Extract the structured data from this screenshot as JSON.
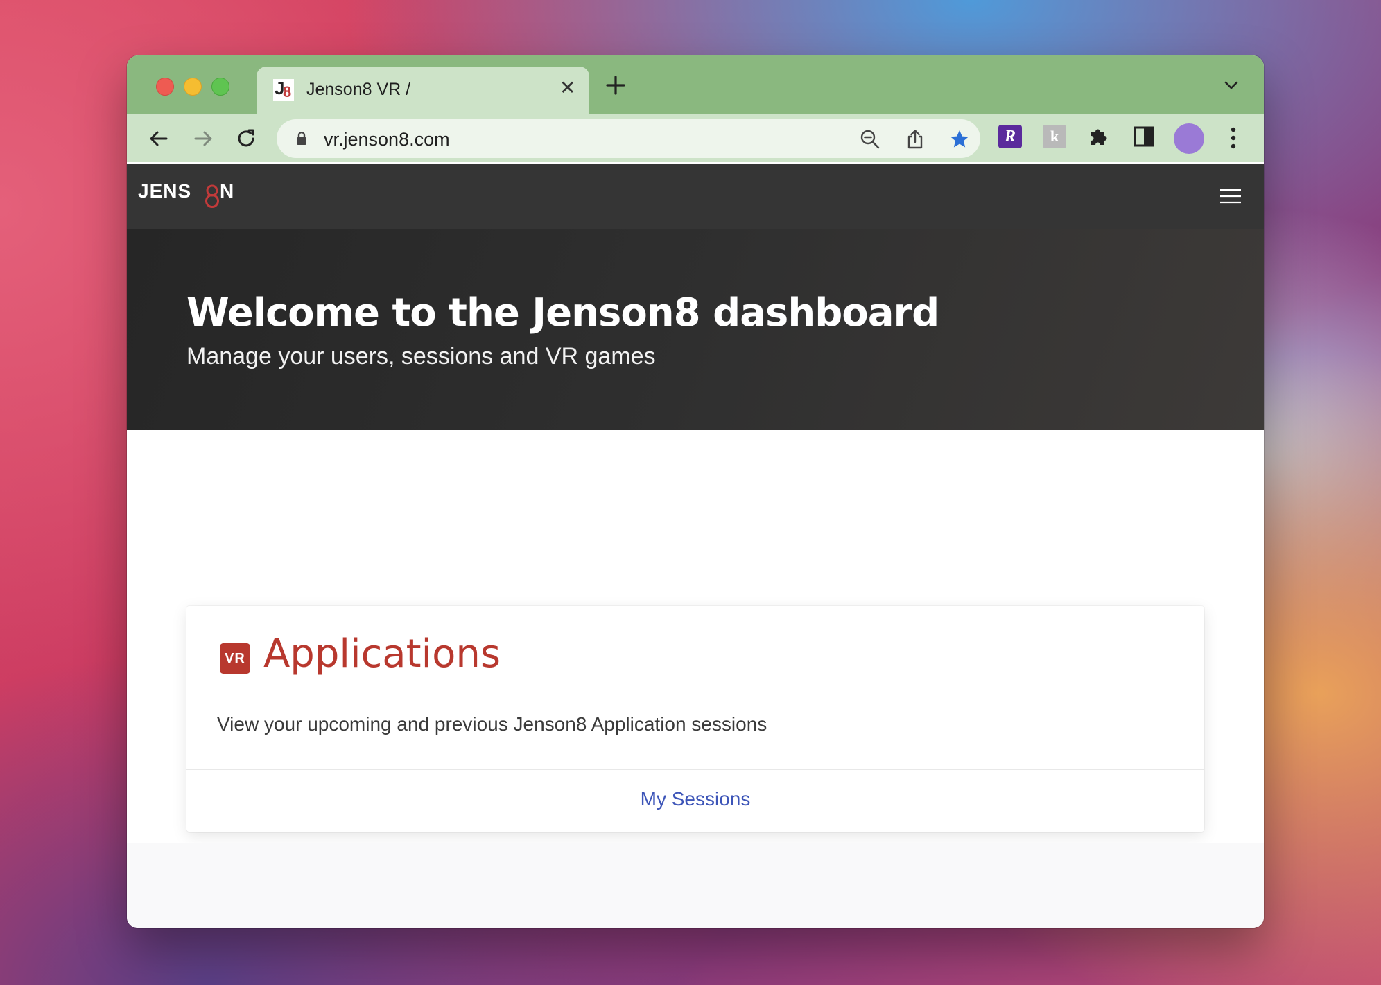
{
  "browser": {
    "tab": {
      "title": "Jenson8 VR /",
      "favicon": "jenson8-favicon"
    },
    "address_bar": {
      "url": "vr.jenson8.com"
    },
    "toolbar_icons": [
      "back-icon",
      "forward-icon",
      "reload-icon",
      "lock-icon",
      "zoom-out-icon",
      "share-icon",
      "bookmark-star-icon"
    ],
    "extensions": {
      "ext1_letter": "R",
      "ext2_letter": "k"
    }
  },
  "site": {
    "logo_text": "JENS8N",
    "hero": {
      "title": "Welcome to the Jenson8 dashboard",
      "subtitle": "Manage your users, sessions and VR games"
    },
    "card": {
      "badge": "VR",
      "title": "Applications",
      "description": "View your upcoming and previous Jenson8 Application sessions",
      "link_label": "My Sessions"
    }
  },
  "colors": {
    "tabbar": "#8ab87f",
    "toolbar": "#cde3c8",
    "site_nav": "#353535",
    "accent_red": "#b8382e",
    "link_blue": "#3d55b8",
    "bookmark_star": "#2b6fd6"
  }
}
